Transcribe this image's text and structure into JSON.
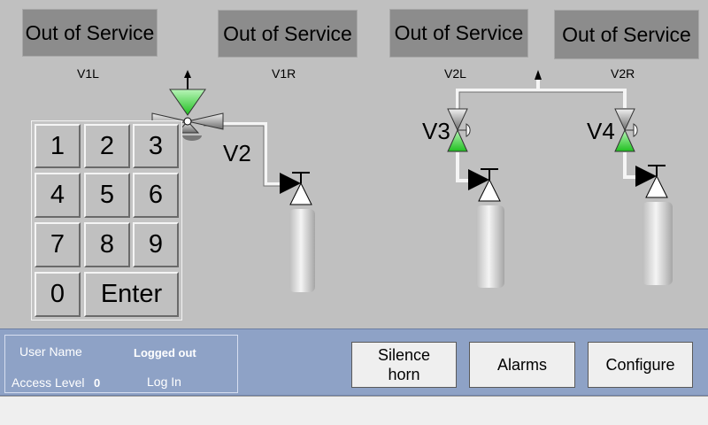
{
  "status_boxes": [
    {
      "id": "v1l",
      "text": "Out of Service"
    },
    {
      "id": "v1r",
      "text": "Out of Service"
    },
    {
      "id": "v2l",
      "text": "Out of Service"
    },
    {
      "id": "v2r",
      "text": "Out of Service"
    }
  ],
  "channel_labels": {
    "v1l": "V1L",
    "v1r": "V1R",
    "v2l": "V2L",
    "v2r": "V2R"
  },
  "valve_tags": {
    "v2": "V2",
    "v3": "V3",
    "v4": "V4"
  },
  "keypad": {
    "keys": [
      "1",
      "2",
      "3",
      "4",
      "5",
      "6",
      "7",
      "8",
      "9",
      "0"
    ],
    "enter_label": "Enter"
  },
  "user_panel": {
    "username_label": "User Name",
    "username_value": "Logged out",
    "access_label": "Access Level",
    "access_value": "0",
    "login_label": "Log In"
  },
  "buttons": {
    "silence_line1": "Silence",
    "silence_line2": "horn",
    "alarms": "Alarms",
    "configure": "Configure"
  },
  "colors": {
    "background": "#c0c0c0",
    "status_box": "#8c8c8c",
    "valve_active": "#22cc22",
    "panel": "#8ea2c6"
  }
}
